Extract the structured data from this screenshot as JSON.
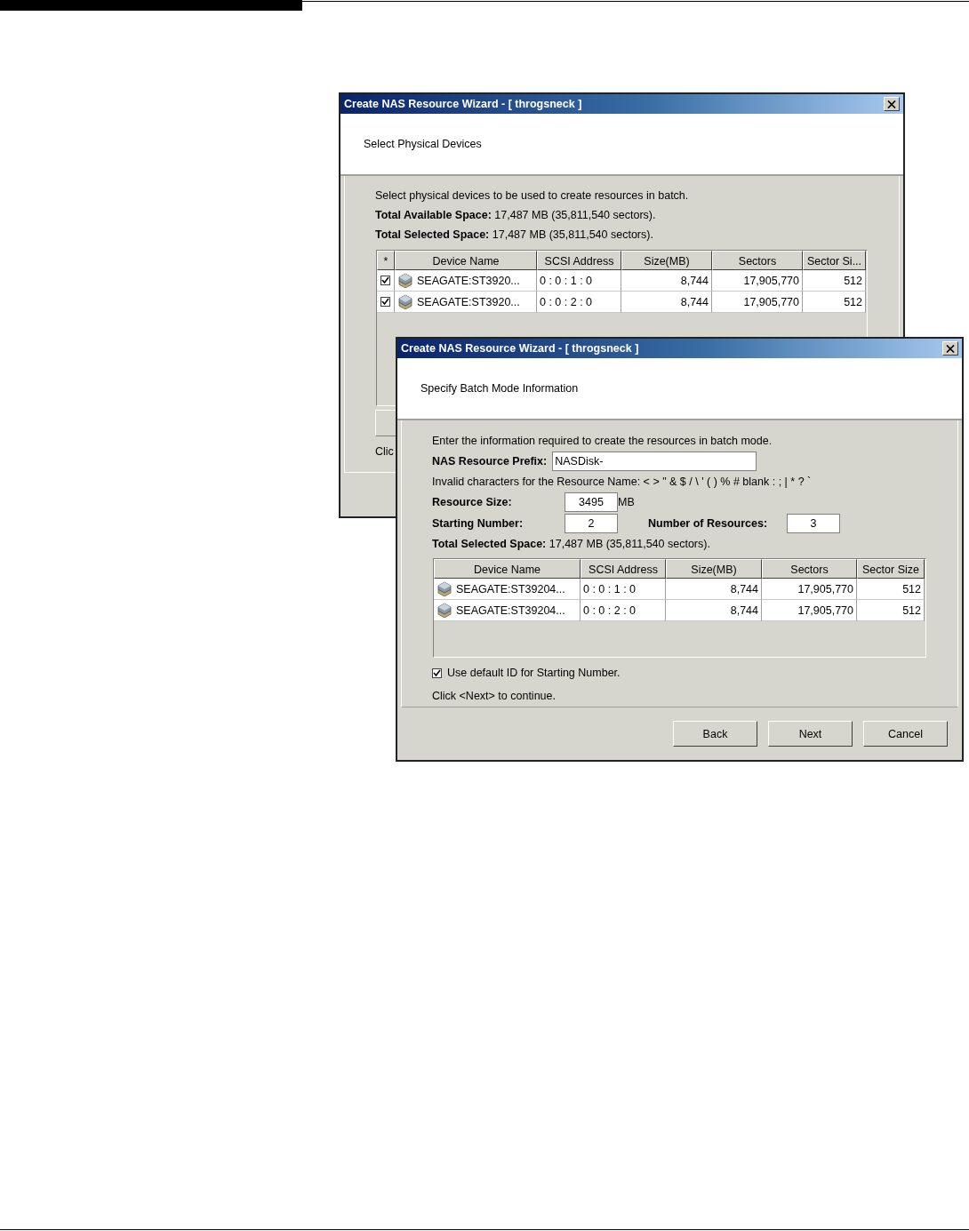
{
  "back_window": {
    "title": "Create NAS Resource Wizard - [ throgsneck ]",
    "heading": "Select Physical Devices",
    "lines": [
      "Select physical devices to be used to create resources in batch.",
      "**Total Available Space:** 17,487 MB (35,811,540 sectors).",
      "**Total Selected Space:** 17,487 MB (35,811,540 sectors)."
    ],
    "table": {
      "columns": [
        "*",
        "Device Name",
        "SCSI Address",
        "Size(MB)",
        "Sectors",
        "Sector Si..."
      ],
      "rows": [
        {
          "checked": true,
          "cells": [
            "",
            "SEAGATE:ST3920...",
            "0 : 0 : 1 : 0",
            "8,744",
            "17,905,770",
            "512"
          ]
        },
        {
          "checked": true,
          "cells": [
            "",
            "SEAGATE:ST3920...",
            "0 : 0 : 2 : 0",
            "8,744",
            "17,905,770",
            "512"
          ]
        }
      ]
    },
    "footer_text": "Clic"
  },
  "front_window": {
    "title": "Create NAS Resource Wizard - [ throgsneck ]",
    "heading": "Specify Batch Mode Information",
    "intro": "Enter the information required to create the resources in batch mode.",
    "prefix": {
      "label": "NAS Resource Prefix:",
      "value": "NASDisk-"
    },
    "invalid_note": "Invalid characters for the Resource Name: < > \" & $ / \\ ' ( ) % # blank : ; | * ? `",
    "resource_size": {
      "label": "Resource Size:",
      "value": "3495",
      "unit": "MB"
    },
    "starting_number": {
      "label": "Starting Number:",
      "value": "2"
    },
    "number_of_resources": {
      "label": "Number of Resources:",
      "value": "3"
    },
    "total_selected": "**Total Selected Space:** 17,487 MB (35,811,540 sectors).",
    "table": {
      "columns": [
        "Device Name",
        "SCSI Address",
        "Size(MB)",
        "Sectors",
        "Sector Size"
      ],
      "rows": [
        {
          "cells": [
            "SEAGATE:ST39204...",
            "0 : 0 : 1 : 0",
            "8,744",
            "17,905,770",
            "512"
          ]
        },
        {
          "cells": [
            "SEAGATE:ST39204...",
            "0 : 0 : 2 : 0",
            "8,744",
            "17,905,770",
            "512"
          ]
        }
      ]
    },
    "default_id": {
      "label": "Use default ID for Starting Number.",
      "checked": true
    },
    "hint": "Click <Next> to continue.",
    "buttons": [
      "Back",
      "Next",
      "Cancel"
    ]
  }
}
